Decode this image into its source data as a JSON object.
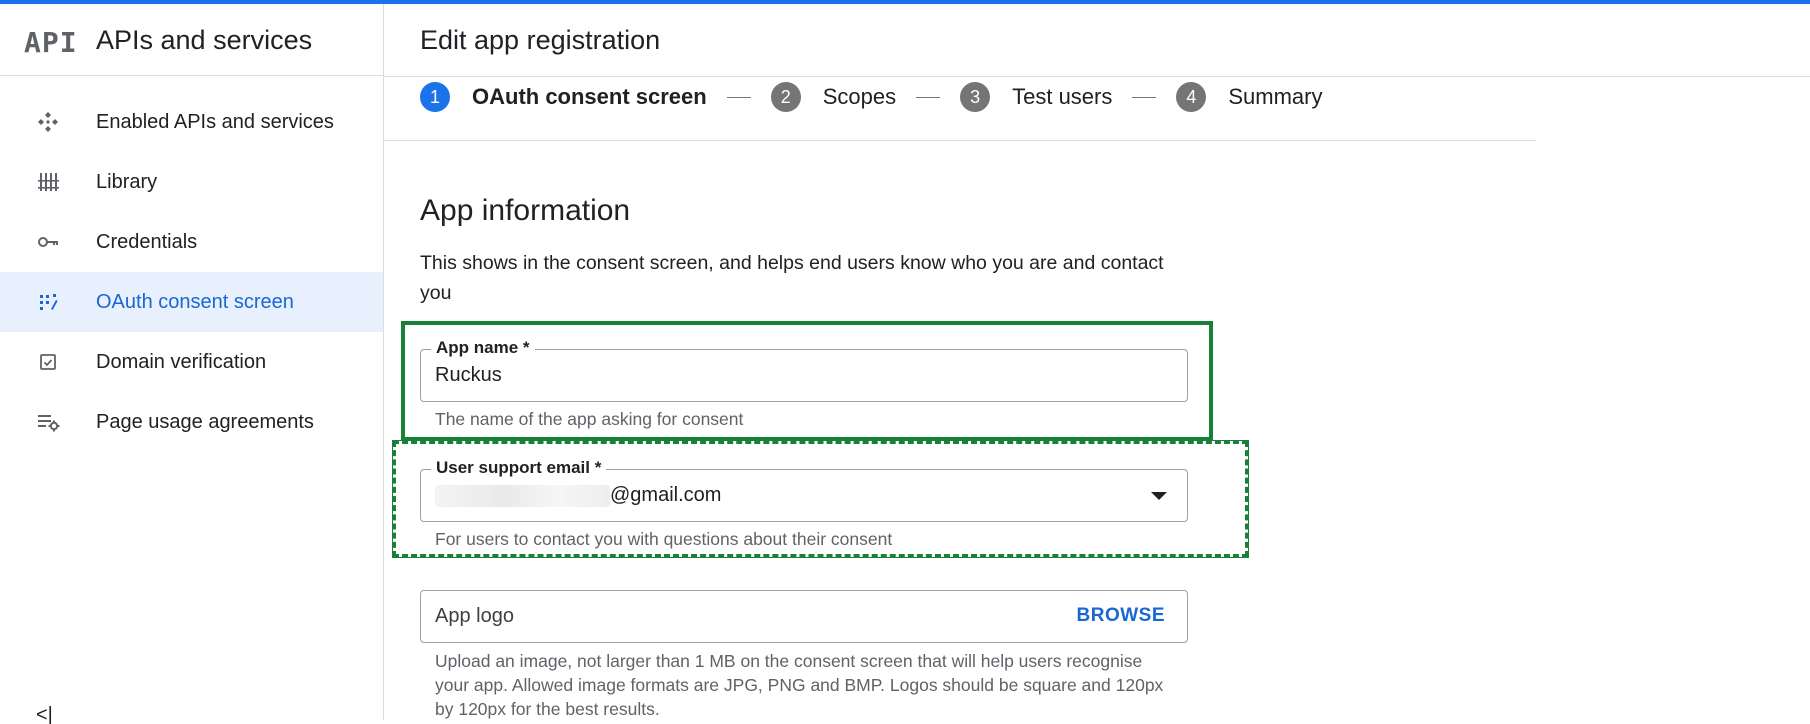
{
  "sidebar": {
    "logo_text": "API",
    "title": "APIs and services",
    "items": [
      {
        "label": "Enabled APIs and services",
        "icon": "enabled-apis-icon"
      },
      {
        "label": "Library",
        "icon": "library-icon"
      },
      {
        "label": "Credentials",
        "icon": "key-icon"
      },
      {
        "label": "OAuth consent screen",
        "icon": "oauth-consent-icon",
        "active": true
      },
      {
        "label": "Domain verification",
        "icon": "checkbox-icon"
      },
      {
        "label": "Page usage agreements",
        "icon": "settings-list-icon"
      }
    ],
    "collapse_glyph": "<|"
  },
  "main": {
    "title": "Edit app registration",
    "steps": [
      {
        "num": "1",
        "label": "OAuth consent screen",
        "active": true
      },
      {
        "num": "2",
        "label": "Scopes"
      },
      {
        "num": "3",
        "label": "Test users"
      },
      {
        "num": "4",
        "label": "Summary"
      }
    ],
    "section": {
      "title": "App information",
      "description": "This shows in the consent screen, and helps end users know who you are and contact you"
    },
    "app_name": {
      "label": "App name *",
      "value": "Ruckus",
      "help": "The name of the app asking for consent"
    },
    "support_email": {
      "label": "User support email *",
      "value_visible": "@gmail.com",
      "help": "For users to contact you with questions about their consent"
    },
    "app_logo": {
      "placeholder": "App logo",
      "browse_label": "BROWSE",
      "help": "Upload an image, not larger than 1 MB on the consent screen that will help users recognise your app. Allowed image formats are JPG, PNG and BMP. Logos should be square and 120px by 120px for the best results."
    }
  },
  "colors": {
    "accent": "#1a73e8",
    "active_bg": "#e8f0fe",
    "highlight": "#188038"
  }
}
